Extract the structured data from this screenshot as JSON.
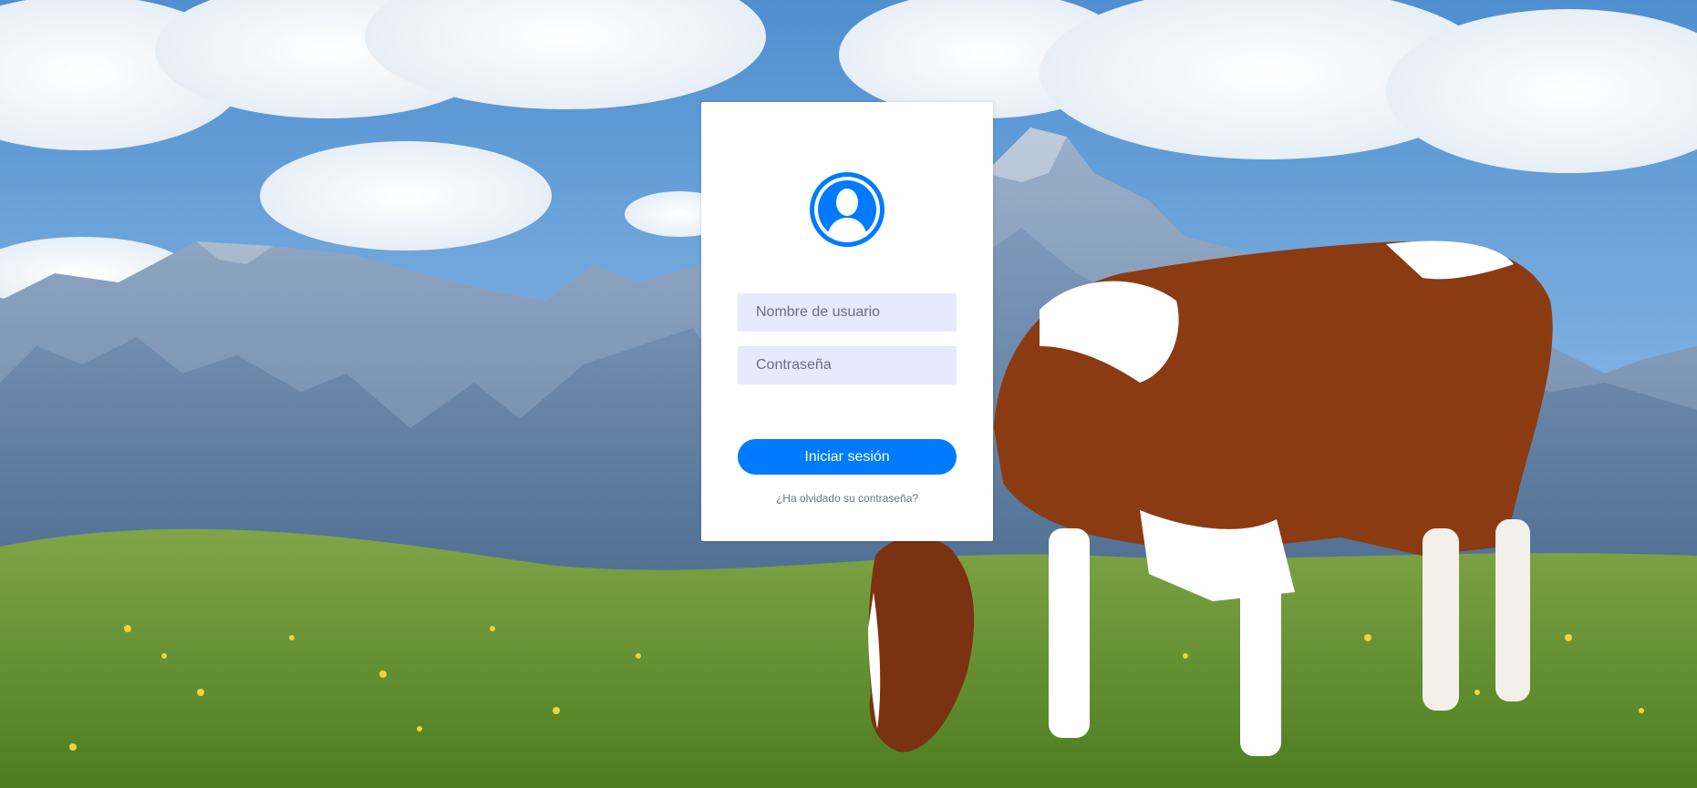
{
  "login": {
    "username_placeholder": "Nombre de usuario",
    "password_placeholder": "Contraseña",
    "submit_label": "Iniciar sesión",
    "forgot_password_link": "¿Ha olvidado su contraseña?"
  },
  "colors": {
    "accent": "#007bff",
    "input_background": "#e8e8ff",
    "card_background": "#ffffff"
  },
  "icons": {
    "avatar": "user-silhouette-icon"
  }
}
